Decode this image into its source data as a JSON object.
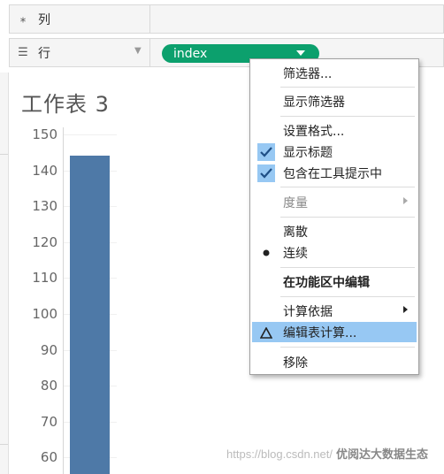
{
  "shelves": {
    "columns": {
      "label": "列",
      "icon": "columns-icon"
    },
    "rows": {
      "label": "行",
      "icon": "rows-icon"
    },
    "pill": {
      "label": "index",
      "color": "#0ca06d"
    }
  },
  "worksheet": {
    "title": "工作表 3"
  },
  "chart_data": {
    "type": "bar",
    "series": [
      {
        "values": [
          144
        ]
      }
    ],
    "y_ticks": [
      "150",
      "140",
      "130",
      "120",
      "110",
      "100",
      "90",
      "80",
      "70",
      "60"
    ],
    "ylim": [
      60,
      150
    ],
    "bar_color": "#4e79a7"
  },
  "context_menu": {
    "items": [
      {
        "label": "筛选器..."
      },
      {
        "label": "显示筛选器"
      },
      {
        "label": "设置格式..."
      },
      {
        "label": "显示标题",
        "checked": true
      },
      {
        "label": "包含在工具提示中",
        "checked": true
      },
      {
        "label": "度量",
        "disabled": true,
        "submenu": true
      },
      {
        "label": "离散"
      },
      {
        "label": "连续",
        "selected_radio": true
      },
      {
        "label": "在功能区中编辑",
        "bold": true
      },
      {
        "label": "计算依据",
        "submenu": true
      },
      {
        "label": "编辑表计算...",
        "highlighted": true,
        "icon": "delta-icon"
      },
      {
        "label": "移除"
      }
    ],
    "highlight_color": "#97c8f3"
  },
  "watermark": {
    "url": "https://blog.csdn.net/",
    "brand": "优阅达大数据生态"
  }
}
